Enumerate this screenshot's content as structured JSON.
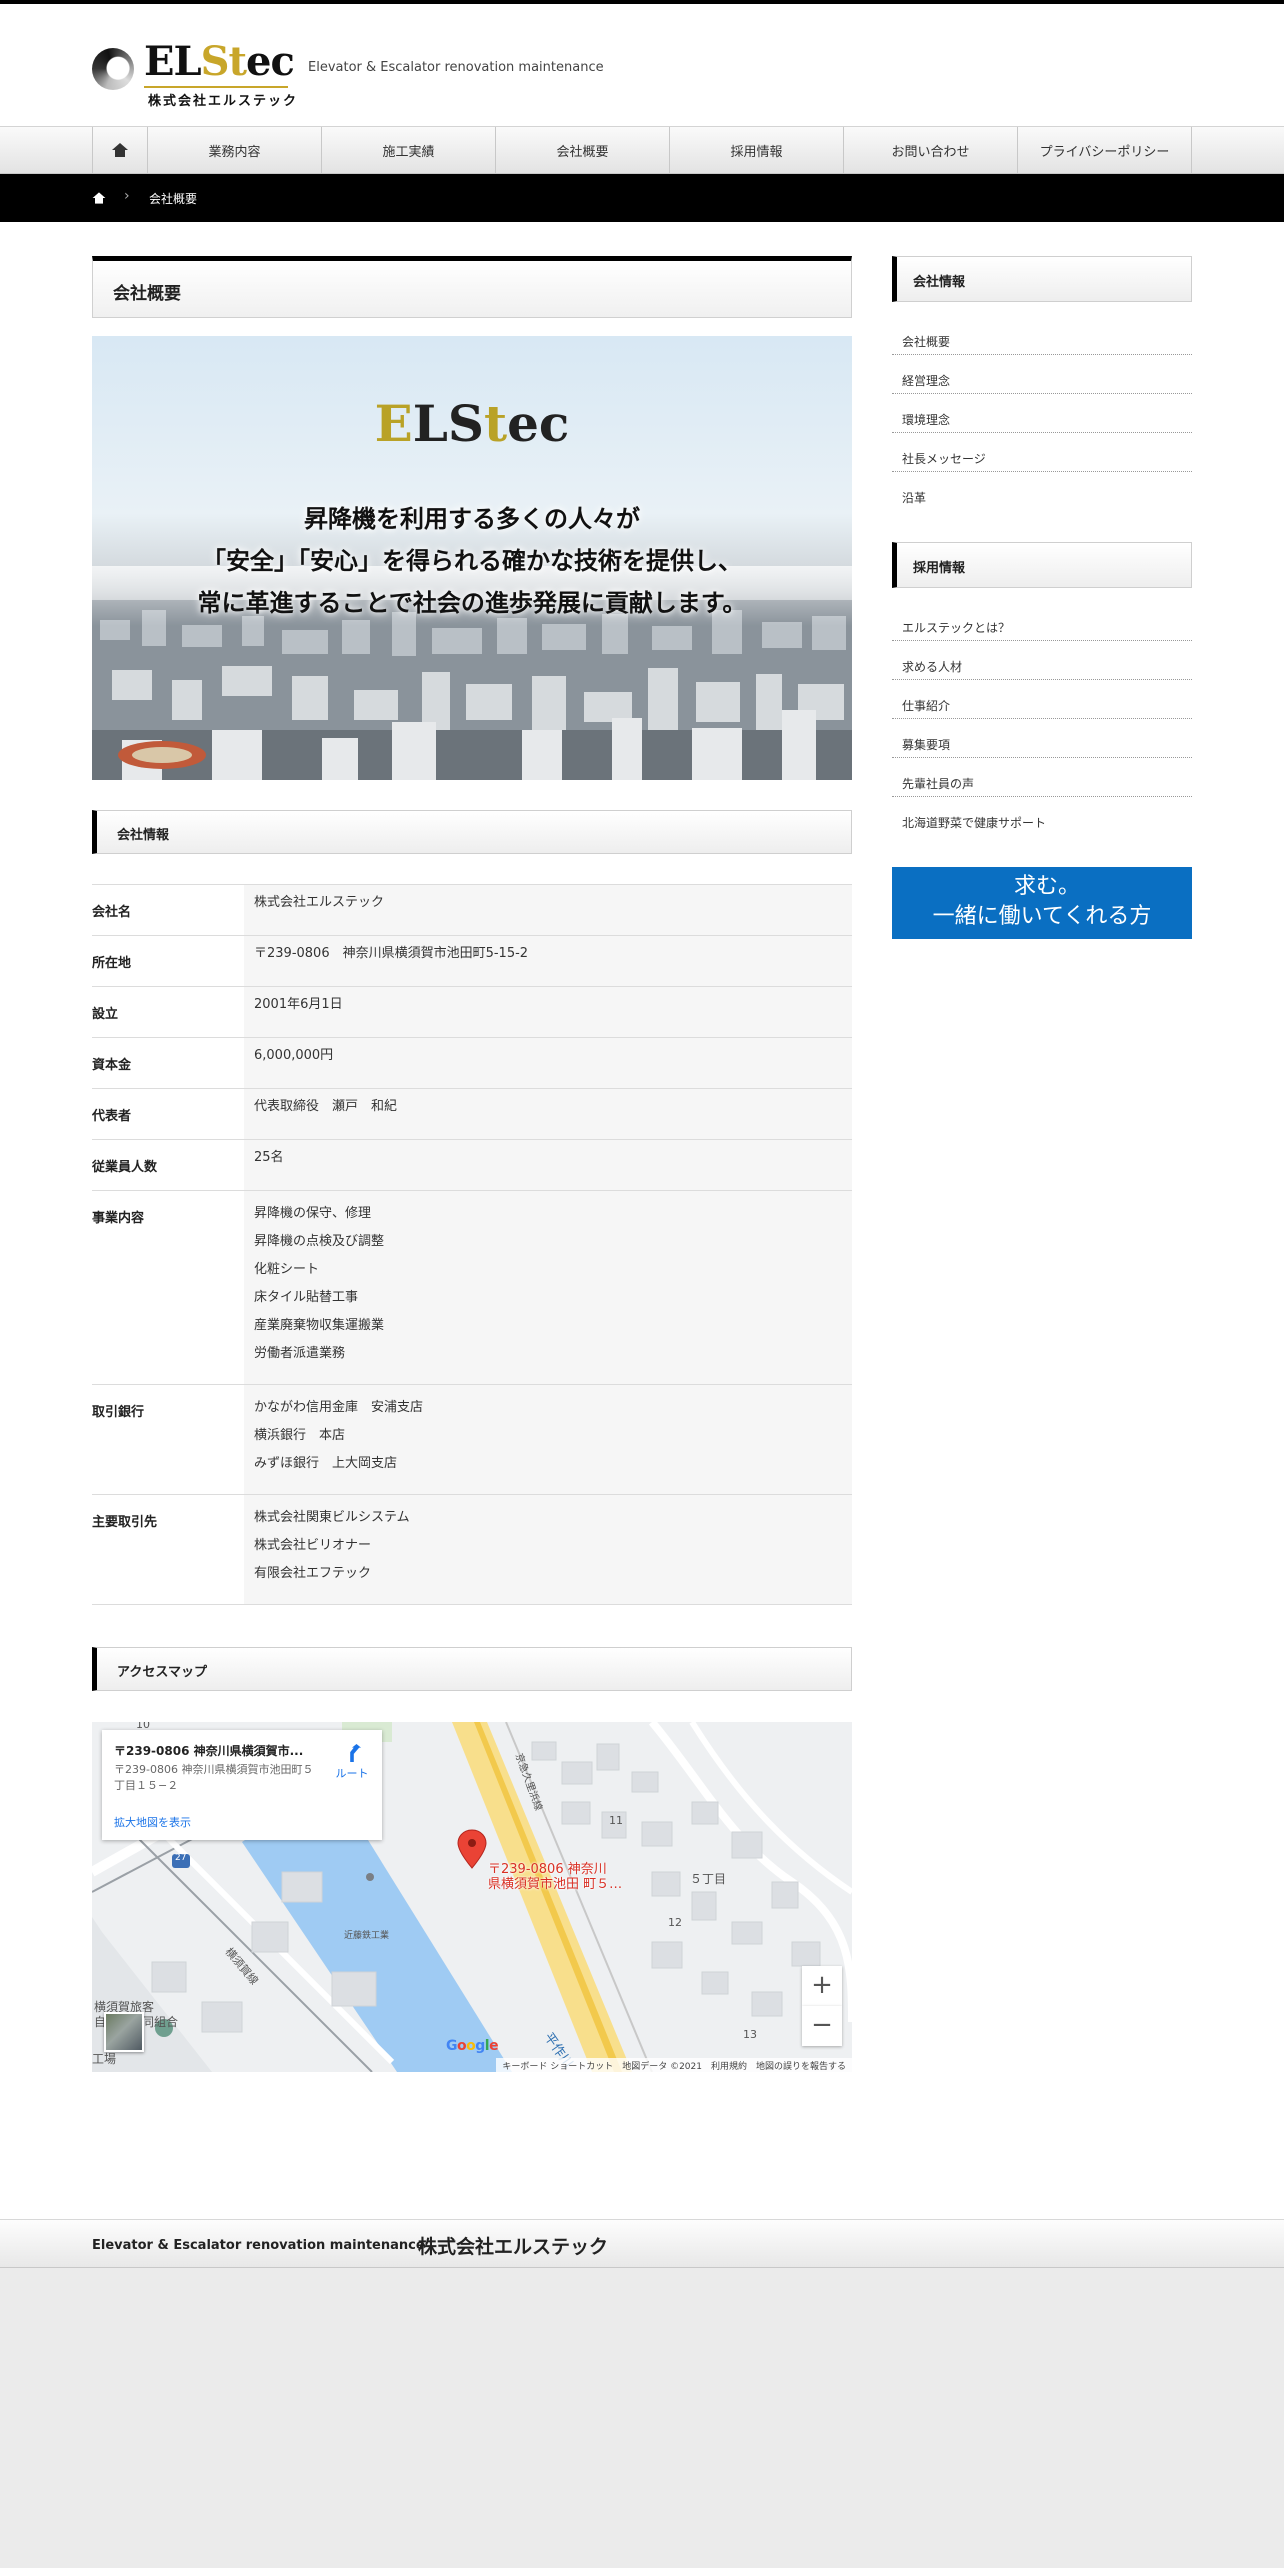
{
  "header": {
    "logo_word_1": "EL",
    "logo_word_2": "S",
    "logo_word_3": "t",
    "logo_word_4": "ec",
    "logo_sub": "株式会社エルステック",
    "tagline": "Elevator & Escalator renovation maintenance"
  },
  "nav": {
    "items": [
      "業務内容",
      "施工実績",
      "会社概要",
      "採用情報",
      "お問い合わせ",
      "プライバシーポリシー"
    ]
  },
  "breadcrumb": {
    "current": "会社概要"
  },
  "main": {
    "title": "会社概要",
    "hero": {
      "brand_1": "E",
      "brand_2": "LS",
      "brand_3": "t",
      "brand_4": "ec",
      "lines": [
        "昇降機を利用する多くの人々が",
        "「安全」「安心」を得られる確かな技術を提供し、",
        "常に革進することで社会の進歩発展に貢献します。"
      ]
    },
    "info_heading": "会社情報",
    "info": [
      {
        "label": "会社名",
        "values": [
          "株式会社エルステック"
        ]
      },
      {
        "label": "所在地",
        "values": [
          "〒239-0806　神奈川県横須賀市池田町5-15-2"
        ]
      },
      {
        "label": "設立",
        "values": [
          "2001年6月1日"
        ]
      },
      {
        "label": "資本金",
        "values": [
          "6,000,000円"
        ]
      },
      {
        "label": "代表者",
        "values": [
          "代表取締役　瀬戸　和紀"
        ]
      },
      {
        "label": "従業員人数",
        "values": [
          "25名"
        ]
      },
      {
        "label": "事業内容",
        "values": [
          "昇降機の保守、修理",
          "昇降機の点検及び調整",
          "化粧シート",
          "床タイル貼替工事",
          "産業廃棄物収集運搬業",
          "労働者派遣業務"
        ]
      },
      {
        "label": "取引銀行",
        "values": [
          "かながわ信用金庫　安浦支店",
          "横浜銀行　本店",
          "みずほ銀行　上大岡支店"
        ]
      },
      {
        "label": "主要取引先",
        "values": [
          "株式会社関東ビルシステム",
          "株式会社ビリオナー",
          "有限会社エフテック"
        ]
      }
    ],
    "map_heading": "アクセスマップ",
    "map": {
      "card_title": "〒239-0806 神奈川県横須賀市...",
      "card_address": "〒239-0806 神奈川県横須賀市池田町５丁目１５−２",
      "card_link": "拡大地図を表示",
      "route_label": "ルート",
      "pin_label_1": "〒239-0806 神奈川",
      "pin_label_2": "県横須賀市池田 町５…",
      "road_label": "京急久里浜線",
      "rail_label": "横須賀線",
      "river_label": "平作川",
      "poi_1": "近藤鉄工業",
      "poi_2_line1": "横須賀旅客",
      "poi_2_line2": "自動車協同組合",
      "poi_3": "工場",
      "area_label": "５丁目",
      "block_10": "10",
      "block_11": "11",
      "block_12": "12",
      "block_13": "13",
      "route_27": "27",
      "zoom_in": "+",
      "zoom_out": "−",
      "google": "Google",
      "footer": "キーボード ショートカット　地図データ ©2021　利用規約　地図の誤りを報告する"
    }
  },
  "sidebar": {
    "company_heading": "会社情報",
    "company_links": [
      "会社概要",
      "経営理念",
      "環境理念",
      "社長メッセージ",
      "沿革"
    ],
    "recruit_heading": "採用情報",
    "recruit_links": [
      "エルステックとは？",
      "求める人材",
      "仕事紹介",
      "募集要項",
      "先輩社員の声",
      "北海道野菜で健康サポート"
    ],
    "banner_line1": "求む。",
    "banner_line2": "一緒に働いてくれる方"
  },
  "footer": {
    "tagline": "Elevator & Escalator renovation maintenance",
    "company": "株式会社エルステック"
  },
  "colors": {
    "accent_gold": "#c8a62a",
    "banner_blue": "#0a6fc2",
    "pin_red": "#d93025"
  }
}
